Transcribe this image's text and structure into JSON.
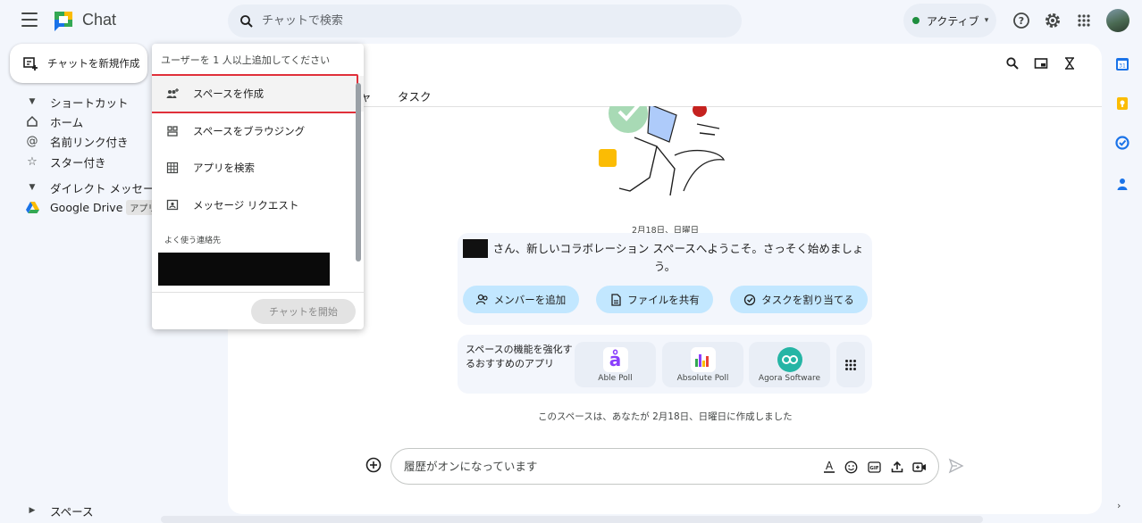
{
  "app": {
    "title": "Chat"
  },
  "search": {
    "placeholder": "チャットで検索"
  },
  "status": {
    "label": "アクティブ",
    "color": "#1e8e3e"
  },
  "top_icons": [
    "help-icon",
    "settings-icon",
    "apps-grid-icon"
  ],
  "sidebar": {
    "new_chat_label": "チャットを新規作成",
    "shortcuts_heading": "ショートカット",
    "items": [
      {
        "label": "ホーム",
        "icon": "home-icon"
      },
      {
        "label": "名前リンク付き",
        "icon": "at-icon"
      },
      {
        "label": "スター付き",
        "icon": "star-icon"
      }
    ],
    "dm_heading": "ダイレクト メッセージ",
    "dm_items": [
      {
        "label": "Google Drive",
        "badge": "アプリ"
      }
    ],
    "spaces_heading": "スペース"
  },
  "popup": {
    "input_placeholder": "ユーザーを 1 人以上追加してください",
    "items": [
      {
        "label": "スペースを作成",
        "icon": "group-add-icon"
      },
      {
        "label": "スペースをブラウジング",
        "icon": "browse-spaces-icon"
      },
      {
        "label": "アプリを検索",
        "icon": "apps-icon"
      },
      {
        "label": "メッセージ リクエスト",
        "icon": "message-request-icon"
      }
    ],
    "frequent_label": "よく使う連絡先",
    "start_button": "チャットを開始"
  },
  "main": {
    "tabs": {
      "fragment": "ャ",
      "task": "タスク"
    },
    "header_icons": [
      "search-icon",
      "picture-in-picture-icon",
      "hourglass-icon"
    ],
    "date_chip": "2月18日、日曜日",
    "welcome_text": "さん、新しいコラボレーション スペースへようこそ。さっそく始めましょう。",
    "actions": [
      {
        "label": "メンバーを追加",
        "icon": "add-member-icon"
      },
      {
        "label": "ファイルを共有",
        "icon": "file-icon"
      },
      {
        "label": "タスクを割り当てる",
        "icon": "task-check-icon"
      }
    ],
    "apps_desc": "スペースの機能を強化するおすすめのアプリ",
    "apps": [
      {
        "name": "Able Poll",
        "color": "#8a3ffc"
      },
      {
        "name": "Absolute Poll",
        "color": "#f4b400"
      },
      {
        "name": "Agora Software",
        "color": "#26b5a5"
      }
    ],
    "created_note": "このスペースは、あなたが 2月18日、日曜日に作成しました",
    "composer_placeholder": "履歴がオンになっています"
  }
}
